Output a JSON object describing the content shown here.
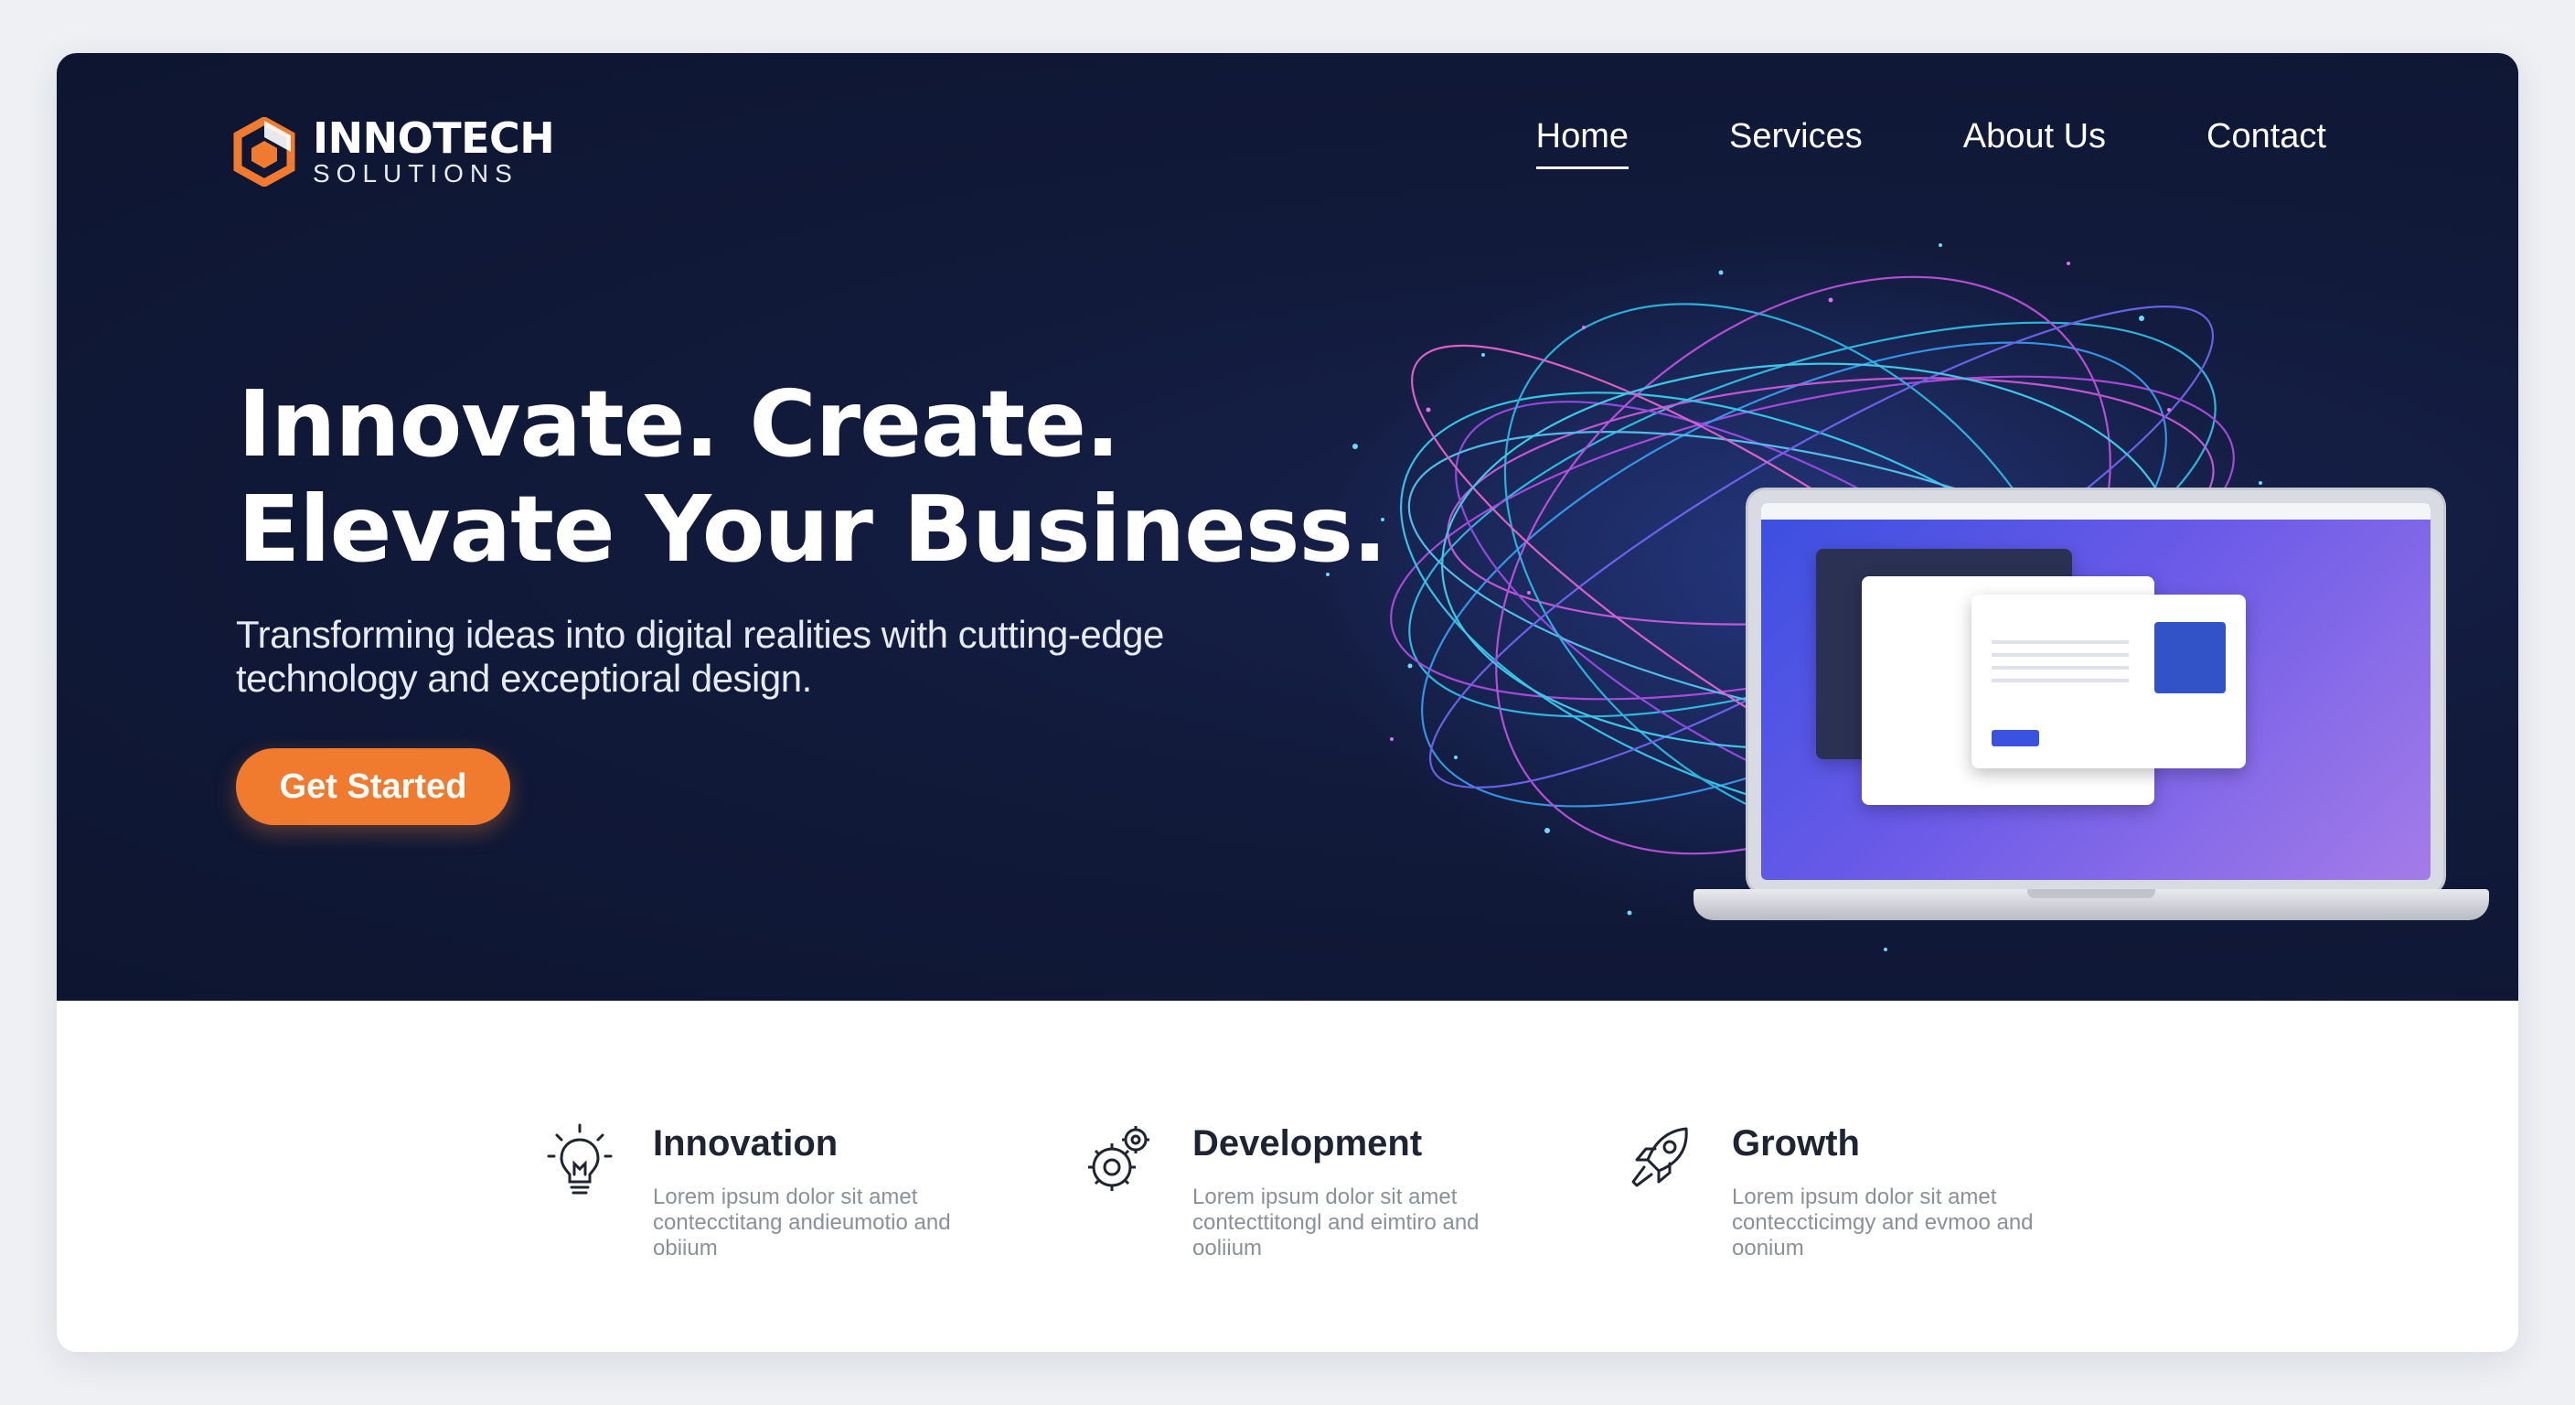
{
  "brand": {
    "name": "INNOTECH",
    "tagline": "SOLUTIONS",
    "accent_color": "#f07a2e"
  },
  "nav": {
    "items": [
      {
        "label": "Home",
        "active": true
      },
      {
        "label": "Services",
        "active": false
      },
      {
        "label": "About Us",
        "active": false
      },
      {
        "label": "Contact",
        "active": false
      }
    ]
  },
  "hero": {
    "headline_line1": "Innovate. Create.",
    "headline_line2": "Elevate Your Business.",
    "subheadline_line1": "Transforming ideas into digital realities with cutting-edge",
    "subheadline_line2": "technology and exceptioral design.",
    "cta_label": "Get Started",
    "background_color": "#111a3a"
  },
  "features": [
    {
      "title": "Innovation",
      "icon": "lightbulb-icon",
      "desc_line1": "Lorem ipsum dolor sit amet",
      "desc_line2": "contecctitang andieumotio and",
      "desc_line3": "obiium"
    },
    {
      "title": "Development",
      "icon": "gears-icon",
      "desc_line1": "Lorem ipsum dolor sit amet",
      "desc_line2": "contecttitongl and eimtiro and",
      "desc_line3": "ooliium"
    },
    {
      "title": "Growth",
      "icon": "rocket-icon",
      "desc_line1": "Lorem ipsum dolor sit amet",
      "desc_line2": "conteccticimgy and evmoo and",
      "desc_line3": "oonium"
    }
  ]
}
